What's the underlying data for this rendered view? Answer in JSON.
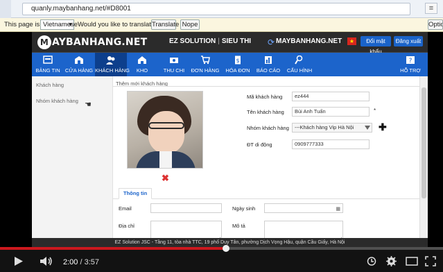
{
  "browser": {
    "url": "quanly.maybanhang.net/#D8001",
    "menu_glyph": "≡"
  },
  "translate": {
    "prefix": "This page is in",
    "language": "Vietnamese",
    "question": "Would you like to translate it?",
    "translate_button": "Translate",
    "nope_button": "Nope",
    "options_button": "Optio"
  },
  "topbar": {
    "logo_letter": "M",
    "logo_text": "AYBANHANG.NET",
    "company": "EZ SOLUTION",
    "company_sub": "SIEU THI",
    "brand": "MAYBANHANG.NET",
    "flag_glyph": "★",
    "change_password": "Đổi mật khẩu",
    "logout": "Đăng xuất"
  },
  "nav": {
    "items": [
      {
        "label": "BẢNG TIN",
        "icon": "dashboard-icon"
      },
      {
        "label": "CỬA HÀNG",
        "icon": "store-icon"
      },
      {
        "label": "KHÁCH HÀNG",
        "icon": "customers-icon"
      },
      {
        "label": "KHO",
        "icon": "warehouse-icon"
      },
      {
        "label": "THU CHI",
        "icon": "money-icon"
      },
      {
        "label": "ĐƠN HÀNG",
        "icon": "cart-icon"
      },
      {
        "label": "HÓA ĐƠN",
        "icon": "invoice-icon"
      },
      {
        "label": "BÁO CÁO",
        "icon": "report-icon"
      },
      {
        "label": "CẤU HÌNH",
        "icon": "settings-icon"
      },
      {
        "label": "HỖ TRỢ",
        "icon": "support-icon"
      }
    ]
  },
  "sidebar": {
    "items": [
      {
        "label": "Khách hàng"
      },
      {
        "label": "Nhóm khách hàng"
      }
    ]
  },
  "form": {
    "breadcrumb": "Thêm mới khách hàng",
    "code_label": "Mã khách hàng",
    "code_value": "ez444",
    "name_label": "Tên khách hàng",
    "name_value": "Bùi Anh Tuấn",
    "group_label": "Nhóm khách hàng",
    "group_value": "---Khách hàng Vip Hà Nội",
    "phone_label": "ĐT di động",
    "phone_value": "0909777333",
    "required_mark": "*",
    "delete_glyph": "✖",
    "add_group_glyph": "✚",
    "tab_info": "Thông tin",
    "email_label": "Email",
    "birthday_label": "Ngày sinh",
    "address_label": "Địa chỉ",
    "description_label": "Mô tả",
    "calendar_glyph": "▦"
  },
  "footer": {
    "text": "EZ Solution JSC - Tầng 11, tòa nhà TTC, 19 phố Duy Tân, phường Dịch Vọng Hậu, quận Cầu Giấy, Hà Nội"
  },
  "player": {
    "progress_fraction": 0.51,
    "current_time": "2:00",
    "separator": " / ",
    "total_time": "3:57"
  },
  "colors": {
    "nav_blue": "#1c64cb",
    "nav_active": "#0d3f8c",
    "progress_red": "#cc181e"
  }
}
